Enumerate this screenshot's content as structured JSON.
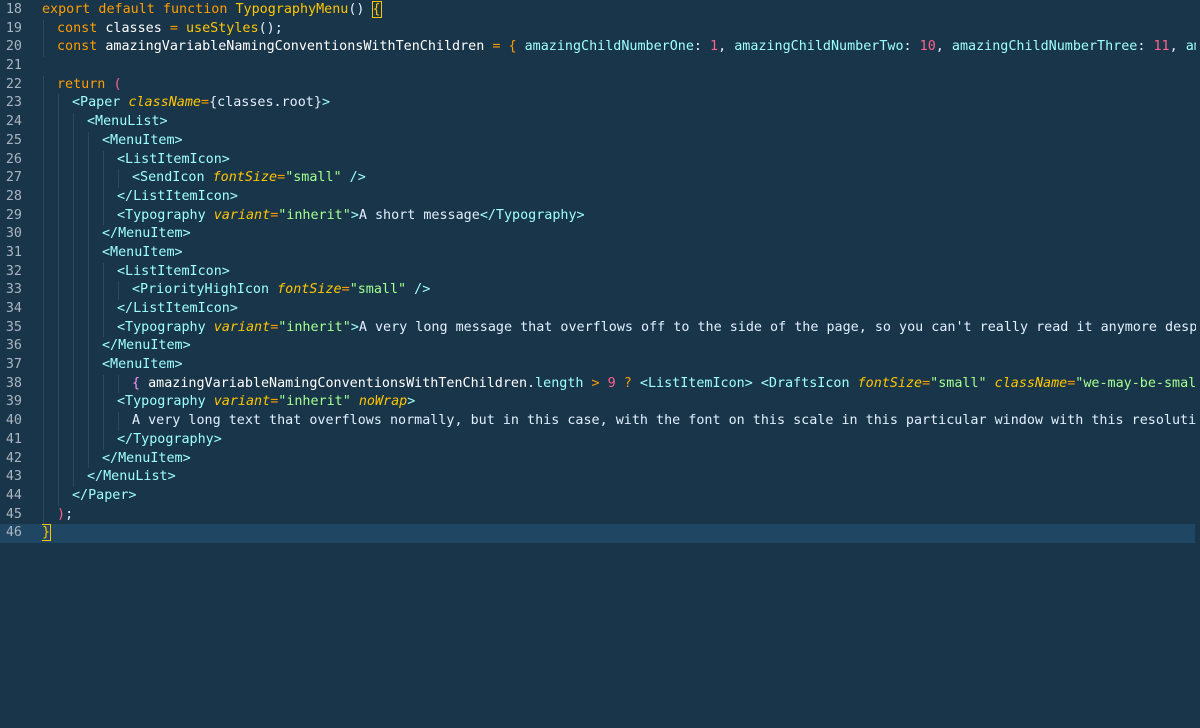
{
  "editor": {
    "lines": [
      {
        "n": "18",
        "indent": 0,
        "tokens": [
          {
            "t": "export default function ",
            "c": "tok-keyword"
          },
          {
            "t": "TypographyMenu",
            "c": "tok-func"
          },
          {
            "t": "() ",
            "c": "tok-paren"
          },
          {
            "t": "{",
            "c": "tok-brace",
            "match": true
          }
        ]
      },
      {
        "n": "19",
        "indent": 1,
        "tokens": [
          {
            "t": "const ",
            "c": "tok-keyword"
          },
          {
            "t": "classes ",
            "c": "tok-plain"
          },
          {
            "t": "= ",
            "c": "tok-op"
          },
          {
            "t": "useStyles",
            "c": "tok-func"
          },
          {
            "t": "()",
            "c": "tok-paren"
          },
          {
            "t": ";",
            "c": "tok-punct"
          }
        ]
      },
      {
        "n": "20",
        "indent": 1,
        "tokens": [
          {
            "t": "const ",
            "c": "tok-keyword"
          },
          {
            "t": "amazingVariableNamingConventionsWithTenChildren ",
            "c": "tok-plain"
          },
          {
            "t": "= ",
            "c": "tok-op"
          },
          {
            "t": "{ ",
            "c": "tok-op"
          },
          {
            "t": "amazingChildNumberOne",
            "c": "tok-prop"
          },
          {
            "t": ": ",
            "c": "tok-punct"
          },
          {
            "t": "1",
            "c": "tok-num"
          },
          {
            "t": ", ",
            "c": "tok-punct"
          },
          {
            "t": "amazingChildNumberTwo",
            "c": "tok-prop"
          },
          {
            "t": ": ",
            "c": "tok-punct"
          },
          {
            "t": "10",
            "c": "tok-num"
          },
          {
            "t": ", ",
            "c": "tok-punct"
          },
          {
            "t": "amazingChildNumberThree",
            "c": "tok-prop"
          },
          {
            "t": ": ",
            "c": "tok-punct"
          },
          {
            "t": "11",
            "c": "tok-num"
          },
          {
            "t": ", ",
            "c": "tok-punct"
          },
          {
            "t": "amazingChildNumb",
            "c": "tok-prop"
          }
        ]
      },
      {
        "n": "21",
        "indent": 0,
        "tokens": []
      },
      {
        "n": "22",
        "indent": 1,
        "tokens": [
          {
            "t": "return ",
            "c": "tok-keyword"
          },
          {
            "t": "(",
            "c": "tok-pink"
          }
        ]
      },
      {
        "n": "23",
        "indent": 2,
        "tokens": [
          {
            "t": "<Paper ",
            "c": "tok-tag"
          },
          {
            "t": "className",
            "c": "tok-attr"
          },
          {
            "t": "=",
            "c": "tok-op"
          },
          {
            "t": "{classes.root}",
            "c": "tok-text"
          },
          {
            "t": ">",
            "c": "tok-tag"
          }
        ]
      },
      {
        "n": "24",
        "indent": 3,
        "tokens": [
          {
            "t": "<MenuList>",
            "c": "tok-tag"
          }
        ]
      },
      {
        "n": "25",
        "indent": 4,
        "tokens": [
          {
            "t": "<MenuItem>",
            "c": "tok-tag"
          }
        ]
      },
      {
        "n": "26",
        "indent": 5,
        "tokens": [
          {
            "t": "<ListItemIcon>",
            "c": "tok-tag"
          }
        ]
      },
      {
        "n": "27",
        "indent": 6,
        "tokens": [
          {
            "t": "<SendIcon ",
            "c": "tok-tag"
          },
          {
            "t": "fontSize",
            "c": "tok-attr"
          },
          {
            "t": "=",
            "c": "tok-op"
          },
          {
            "t": "\"small\"",
            "c": "tok-str"
          },
          {
            "t": " />",
            "c": "tok-tag"
          }
        ]
      },
      {
        "n": "28",
        "indent": 5,
        "tokens": [
          {
            "t": "</ListItemIcon>",
            "c": "tok-tag"
          }
        ]
      },
      {
        "n": "29",
        "indent": 5,
        "tokens": [
          {
            "t": "<Typography ",
            "c": "tok-tag"
          },
          {
            "t": "variant",
            "c": "tok-attr"
          },
          {
            "t": "=",
            "c": "tok-op"
          },
          {
            "t": "\"inherit\"",
            "c": "tok-str"
          },
          {
            "t": ">",
            "c": "tok-tag"
          },
          {
            "t": "A short message",
            "c": "tok-text"
          },
          {
            "t": "</Typography>",
            "c": "tok-tag"
          }
        ]
      },
      {
        "n": "30",
        "indent": 4,
        "tokens": [
          {
            "t": "</MenuItem>",
            "c": "tok-tag"
          }
        ]
      },
      {
        "n": "31",
        "indent": 4,
        "tokens": [
          {
            "t": "<MenuItem>",
            "c": "tok-tag"
          }
        ]
      },
      {
        "n": "32",
        "indent": 5,
        "tokens": [
          {
            "t": "<ListItemIcon>",
            "c": "tok-tag"
          }
        ]
      },
      {
        "n": "33",
        "indent": 6,
        "tokens": [
          {
            "t": "<PriorityHighIcon ",
            "c": "tok-tag"
          },
          {
            "t": "fontSize",
            "c": "tok-attr"
          },
          {
            "t": "=",
            "c": "tok-op"
          },
          {
            "t": "\"small\"",
            "c": "tok-str"
          },
          {
            "t": " />",
            "c": "tok-tag"
          }
        ]
      },
      {
        "n": "34",
        "indent": 5,
        "tokens": [
          {
            "t": "</ListItemIcon>",
            "c": "tok-tag"
          }
        ]
      },
      {
        "n": "35",
        "indent": 5,
        "tokens": [
          {
            "t": "<Typography ",
            "c": "tok-tag"
          },
          {
            "t": "variant",
            "c": "tok-attr"
          },
          {
            "t": "=",
            "c": "tok-op"
          },
          {
            "t": "\"inherit\"",
            "c": "tok-str"
          },
          {
            "t": ">",
            "c": "tok-tag"
          },
          {
            "t": "A very long message that overflows off to the side of the page, so you can't really read it anymore despite the fact t",
            "c": "tok-text"
          }
        ]
      },
      {
        "n": "36",
        "indent": 4,
        "tokens": [
          {
            "t": "</MenuItem>",
            "c": "tok-tag"
          }
        ]
      },
      {
        "n": "37",
        "indent": 4,
        "tokens": [
          {
            "t": "<MenuItem>",
            "c": "tok-tag"
          }
        ]
      },
      {
        "n": "38",
        "indent": 6,
        "tokens": [
          {
            "t": "{ ",
            "c": "tok-mag"
          },
          {
            "t": "amazingVariableNamingConventionsWithTenChildren",
            "c": "tok-plain"
          },
          {
            "t": ".",
            "c": "tok-punct"
          },
          {
            "t": "length ",
            "c": "tok-prop"
          },
          {
            "t": "> ",
            "c": "tok-op"
          },
          {
            "t": "9 ",
            "c": "tok-num"
          },
          {
            "t": "? ",
            "c": "tok-op"
          },
          {
            "t": "<ListItemIcon> ",
            "c": "tok-tag"
          },
          {
            "t": "<DraftsIcon ",
            "c": "tok-tag"
          },
          {
            "t": "fontSize",
            "c": "tok-attr"
          },
          {
            "t": "=",
            "c": "tok-op"
          },
          {
            "t": "\"small\" ",
            "c": "tok-str"
          },
          {
            "t": "className",
            "c": "tok-attr"
          },
          {
            "t": "=",
            "c": "tok-op"
          },
          {
            "t": "\"we-may-be-small-in-font-but-",
            "c": "tok-str"
          }
        ]
      },
      {
        "n": "39",
        "indent": 5,
        "tokens": [
          {
            "t": "<Typography ",
            "c": "tok-tag"
          },
          {
            "t": "variant",
            "c": "tok-attr"
          },
          {
            "t": "=",
            "c": "tok-op"
          },
          {
            "t": "\"inherit\" ",
            "c": "tok-str"
          },
          {
            "t": "noWrap",
            "c": "tok-attr"
          },
          {
            "t": ">",
            "c": "tok-tag"
          }
        ]
      },
      {
        "n": "40",
        "indent": 6,
        "tokens": [
          {
            "t": "A very long text that overflows normally, but in this case, with the font on this scale in this particular window with this resolution, it's fine.",
            "c": "tok-text"
          }
        ]
      },
      {
        "n": "41",
        "indent": 5,
        "tokens": [
          {
            "t": "</Typography>",
            "c": "tok-tag"
          }
        ]
      },
      {
        "n": "42",
        "indent": 4,
        "tokens": [
          {
            "t": "</MenuItem>",
            "c": "tok-tag"
          }
        ]
      },
      {
        "n": "43",
        "indent": 3,
        "tokens": [
          {
            "t": "</MenuList>",
            "c": "tok-tag"
          }
        ]
      },
      {
        "n": "44",
        "indent": 2,
        "tokens": [
          {
            "t": "</Paper>",
            "c": "tok-tag"
          }
        ]
      },
      {
        "n": "45",
        "indent": 1,
        "tokens": [
          {
            "t": ")",
            "c": "tok-pink"
          },
          {
            "t": ";",
            "c": "tok-punct"
          }
        ]
      },
      {
        "n": "46",
        "indent": 0,
        "current": true,
        "tokens": [
          {
            "t": "}",
            "c": "tok-brace",
            "match": true
          }
        ]
      }
    ]
  }
}
